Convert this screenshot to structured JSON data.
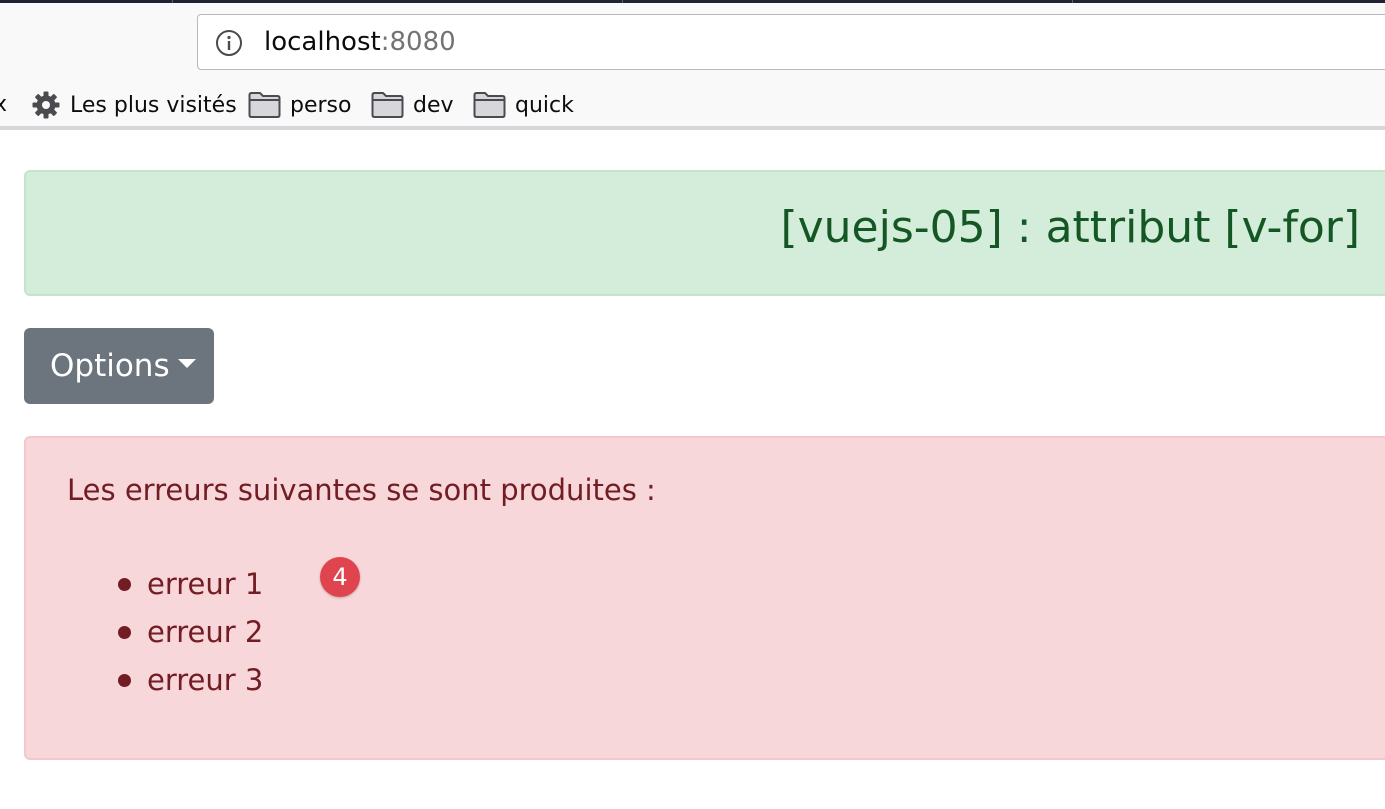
{
  "browser": {
    "url_host": "localhost",
    "url_port": ":8080",
    "bookmarks": [
      {
        "label": "Les plus visités",
        "icon": "gear-icon"
      },
      {
        "label": "perso",
        "icon": "folder-icon"
      },
      {
        "label": "dev",
        "icon": "folder-icon"
      },
      {
        "label": "quick",
        "icon": "folder-icon"
      }
    ],
    "bookmark_cut_label": "x"
  },
  "page": {
    "title": "[vuejs-05] : attribut [v-for]",
    "options_button": "Options",
    "errors_heading": "Les erreurs suivantes se sont produites :",
    "errors": [
      "erreur 1",
      "erreur 2",
      "erreur 3"
    ],
    "badge_count": "4"
  },
  "colors": {
    "success_bg": "#d4edda",
    "success_text": "#155724",
    "danger_bg": "#f8d7da",
    "danger_text": "#721c24",
    "secondary_btn": "#6c757d",
    "badge": "#e0444e"
  }
}
